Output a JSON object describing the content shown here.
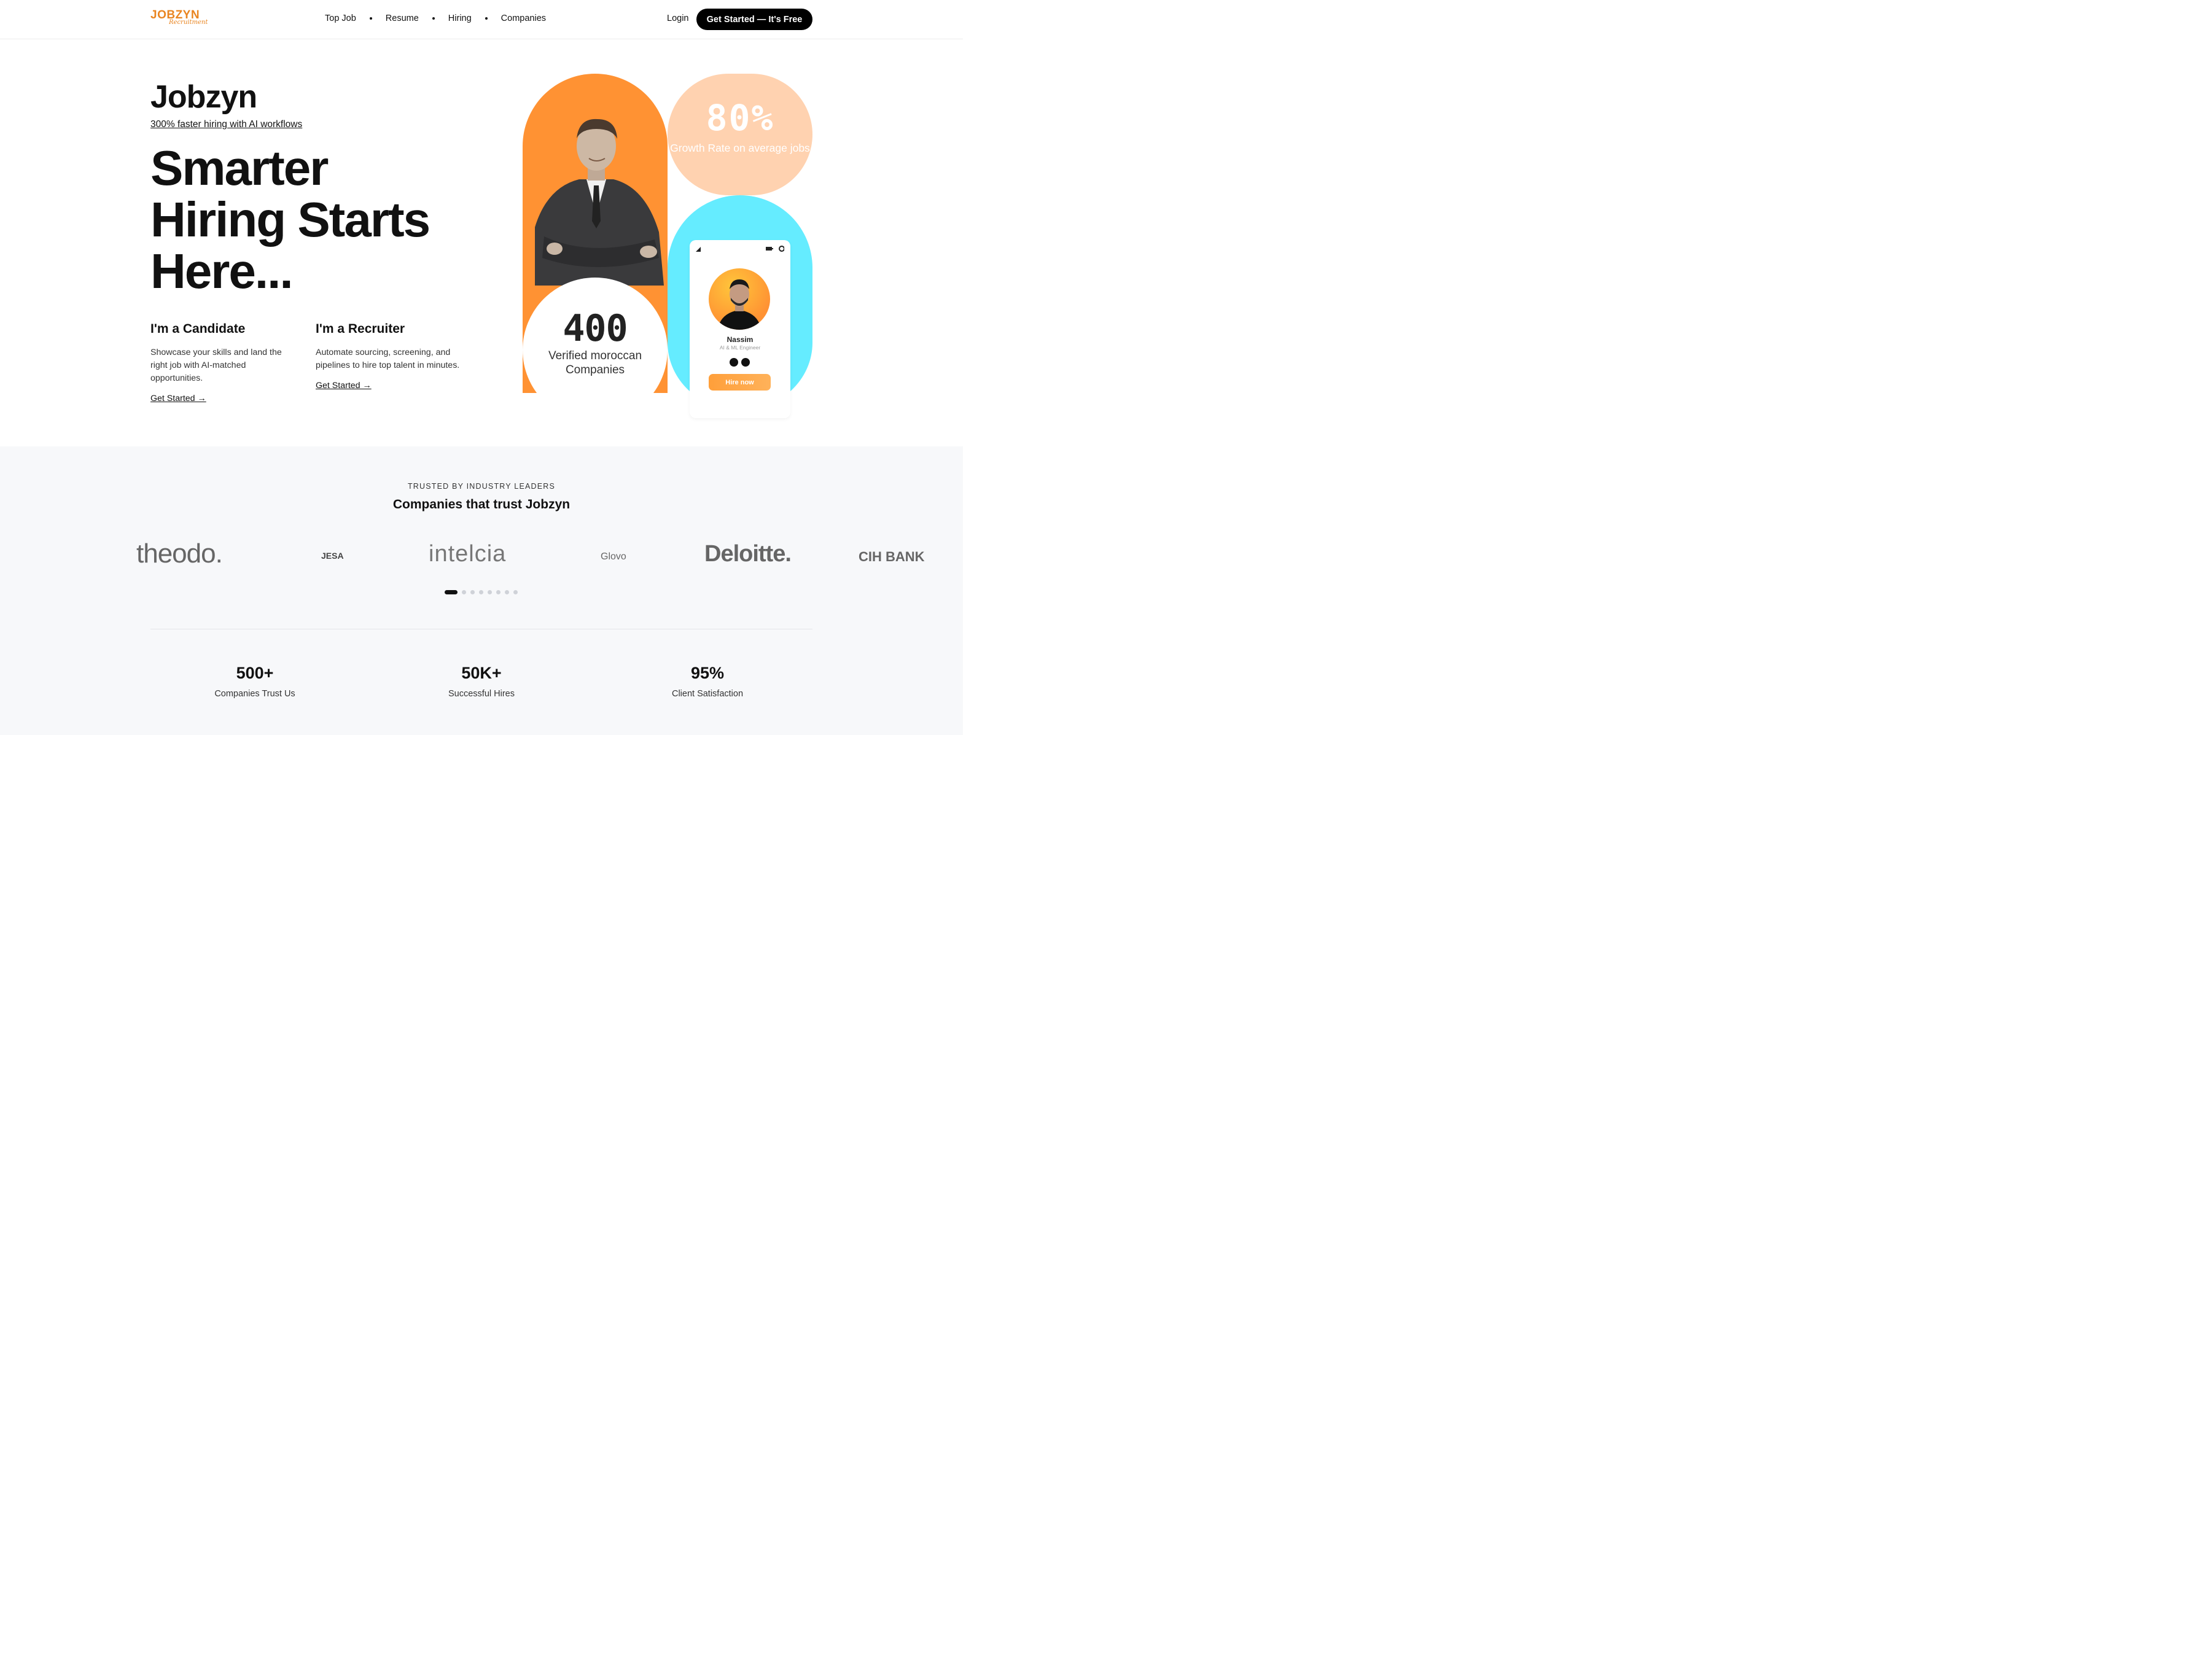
{
  "nav": {
    "logo_text": "JOBZYN",
    "logo_sub": "Recruitment",
    "links": [
      "Top Job",
      "Resume",
      "Hiring",
      "Companies"
    ],
    "login": "Login",
    "cta": "Get Started — It's Free"
  },
  "hero": {
    "brand": "Jobzyn",
    "tagline": "300% faster hiring with AI workflows",
    "headline": [
      "Smarter",
      "Hiring Starts",
      "Here..."
    ],
    "candidate": {
      "title": "I'm a Candidate",
      "body": "Showcase your skills and land the right job with AI-matched opportunities.",
      "link": "Get Started →"
    },
    "recruiter": {
      "title": "I'm a Recruiter",
      "body": "Automate sourcing, screening, and pipelines to hire top talent in minutes.",
      "link": "Get Started →"
    },
    "growth": {
      "value": "80%",
      "caption": "Growth Rate on average jobs"
    },
    "companies_stat": {
      "value": "400",
      "caption": "Verified moroccan Companies"
    },
    "profile": {
      "name": "Nassim",
      "role": "AI & ML Engineer",
      "button": "Hire now"
    },
    "colors": {
      "orange": "#ff9233",
      "peach": "#ffd2b0",
      "cyan": "#65ecff"
    }
  },
  "trusted": {
    "eyebrow": "TRUSTED BY INDUSTRY LEADERS",
    "title": "Companies that trust Jobzyn",
    "logos": [
      "theodo.",
      "JESA",
      "intelcia",
      "Glovo",
      "Deloitte.",
      "CIH BANK"
    ],
    "carousel": {
      "pages": 9,
      "active": 1
    },
    "stats": [
      {
        "value": "500+",
        "label": "Companies Trust Us"
      },
      {
        "value": "50K+",
        "label": "Successful Hires"
      },
      {
        "value": "95%",
        "label": "Client Satisfaction"
      }
    ]
  }
}
